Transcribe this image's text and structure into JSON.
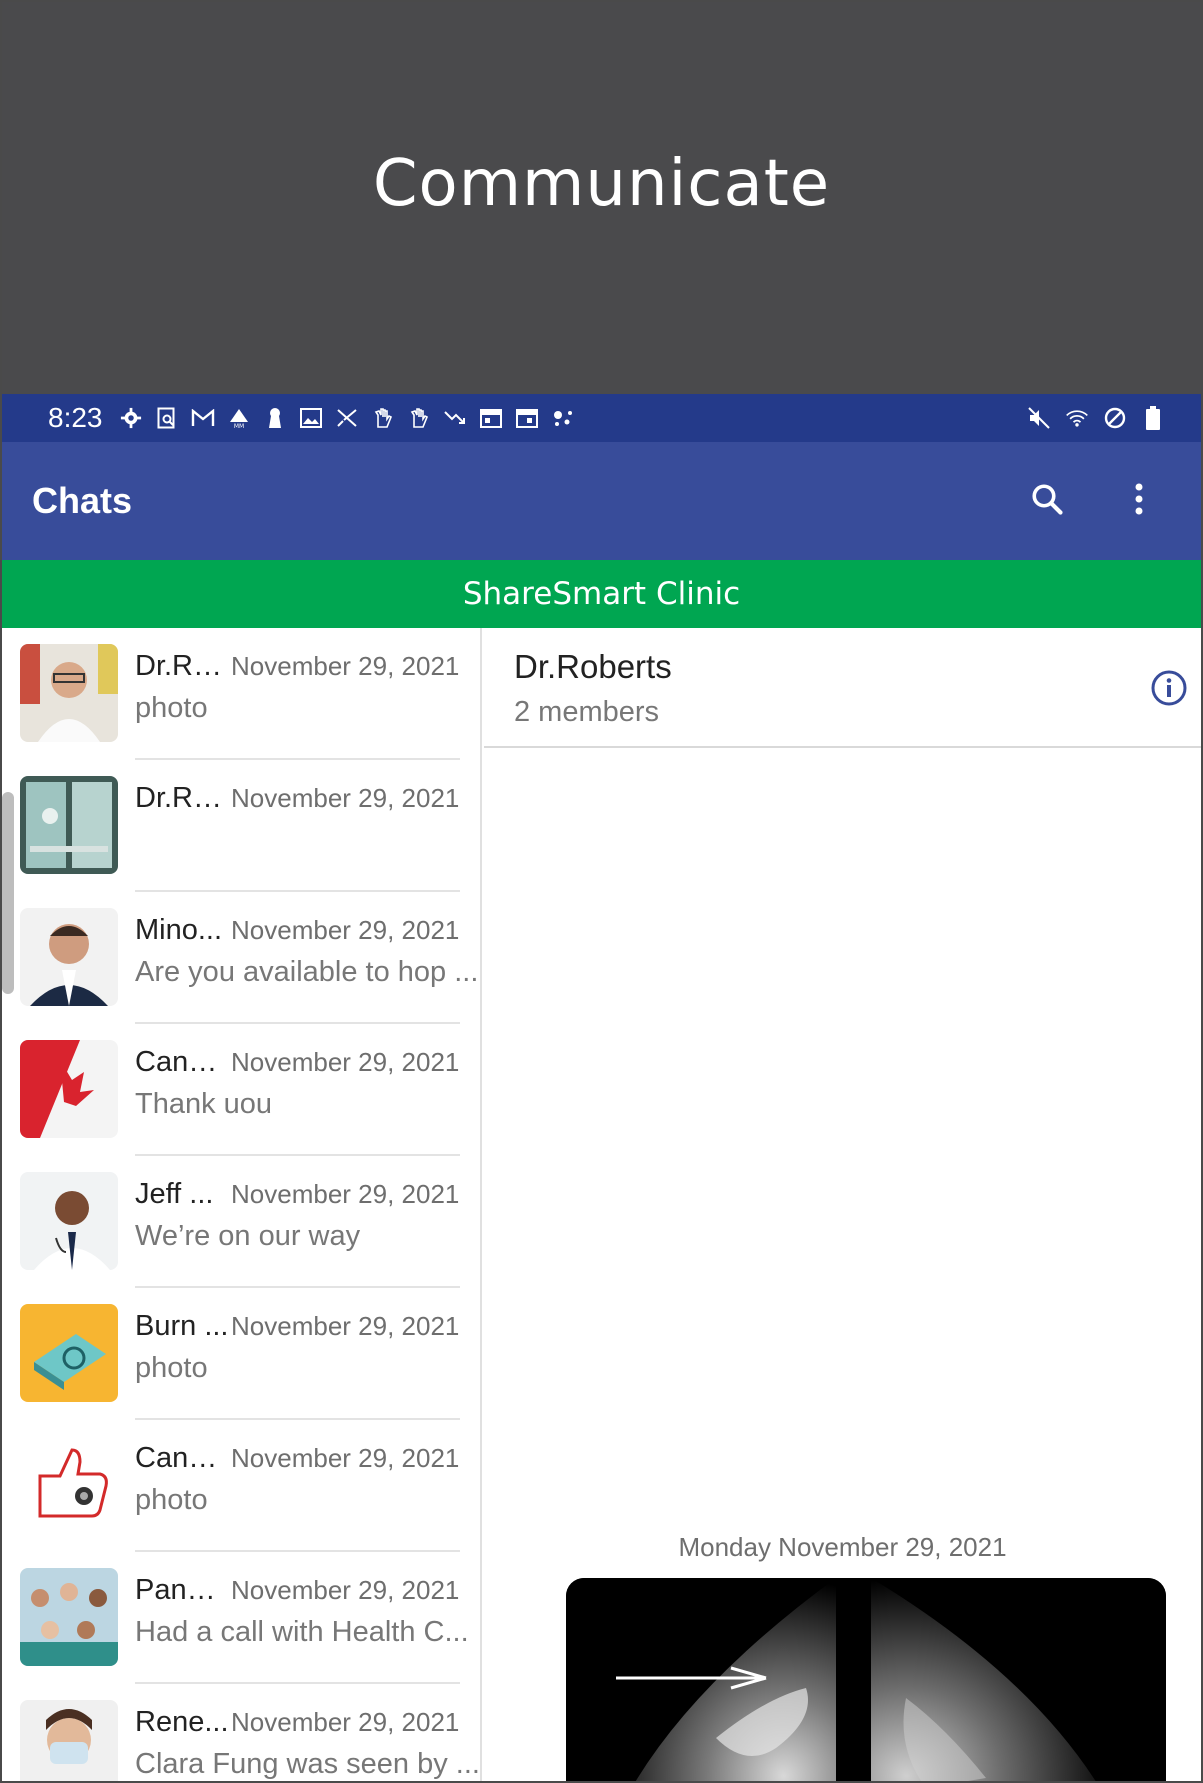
{
  "banner": {
    "title": "Communicate"
  },
  "status_bar": {
    "time": "8:23",
    "left_icons": [
      "gear-icon",
      "search-doc-icon",
      "gmail-icon",
      "drive-icon",
      "keyhole-icon",
      "image-icon",
      "scissors-icon",
      "hand-icon",
      "hand-icon",
      "trend-down-icon",
      "calendar-icon",
      "calendar-icon",
      "assistant-dots-icon"
    ],
    "right_icons": [
      "mute-icon",
      "wifi-icon",
      "do-not-disturb-icon",
      "battery-icon"
    ]
  },
  "app_bar": {
    "title": "Chats",
    "search_icon": "search-icon",
    "menu_icon": "more-vert-icon"
  },
  "clinic": {
    "name": "ShareSmart Clinic"
  },
  "chats": [
    {
      "name": "Dr.Ro...",
      "date": "November 29, 2021",
      "preview": "photo",
      "avatar": "doctor-glasses"
    },
    {
      "name": "Dr.Ro...",
      "date": "November 29, 2021",
      "preview": "",
      "avatar": "clinic-room"
    },
    {
      "name": "Mino...",
      "date": "November 29, 2021",
      "preview": "Are you available to hop ...",
      "avatar": "man-suit"
    },
    {
      "name": "CanC...",
      "date": "November 29, 2021",
      "preview": "Thank uou",
      "avatar": "canada-flag"
    },
    {
      "name": "Jeff ...",
      "date": "November 29, 2021",
      "preview": "We’re on our way",
      "avatar": "doctor-smiling"
    },
    {
      "name": "Burn ...",
      "date": "November 29, 2021",
      "preview": "photo",
      "avatar": "burn-unit"
    },
    {
      "name": "CanC...",
      "date": "November 29, 2021",
      "preview": "photo",
      "avatar": "thumbs-up-logo"
    },
    {
      "name": "PanC...",
      "date": "November 29, 2021",
      "preview": "Had a call with Health C...",
      "avatar": "group-doctors"
    },
    {
      "name": "Rene...",
      "date": "November 29, 2021",
      "preview": "Clara Fung was seen by ...",
      "avatar": "nurse-mask"
    }
  ],
  "detail": {
    "name": "Dr.Roberts",
    "members": "2 members",
    "date_separator": "Monday November 29, 2021"
  },
  "colors": {
    "banner": "#4a4a4c",
    "status_bar": "#243a8a",
    "app_bar": "#384c9a",
    "clinic_bar": "#00a651"
  }
}
